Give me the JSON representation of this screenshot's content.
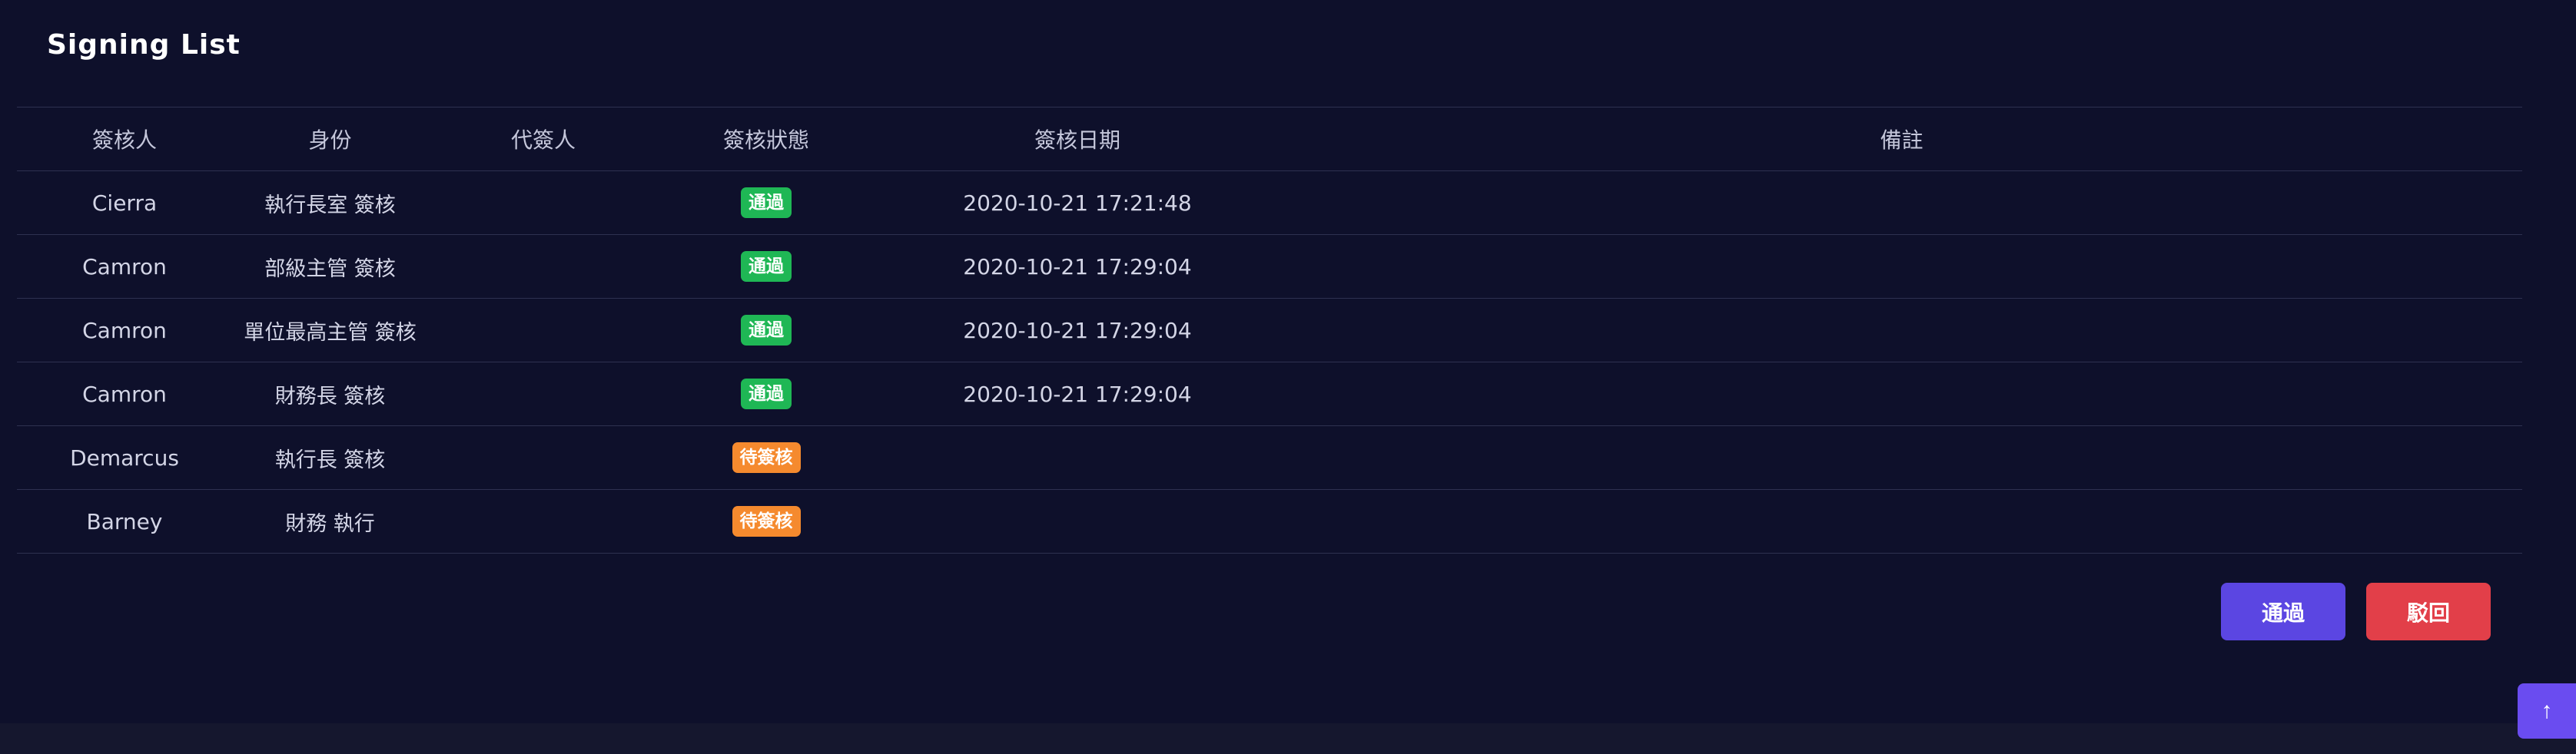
{
  "page": {
    "title": "Signing List"
  },
  "table": {
    "headers": [
      "簽核人",
      "身份",
      "代簽人",
      "簽核狀態",
      "簽核日期",
      "備註"
    ],
    "rows": [
      {
        "signer": "Cierra",
        "role": "執行長室 簽核",
        "proxy": "",
        "status": "通過",
        "status_type": "approved",
        "date": "2020-10-21 17:21:48",
        "note": ""
      },
      {
        "signer": "Camron",
        "role": "部級主管 簽核",
        "proxy": "",
        "status": "通過",
        "status_type": "approved",
        "date": "2020-10-21 17:29:04",
        "note": ""
      },
      {
        "signer": "Camron",
        "role": "單位最高主管 簽核",
        "proxy": "",
        "status": "通過",
        "status_type": "approved",
        "date": "2020-10-21 17:29:04",
        "note": ""
      },
      {
        "signer": "Camron",
        "role": "財務長 簽核",
        "proxy": "",
        "status": "通過",
        "status_type": "approved",
        "date": "2020-10-21 17:29:04",
        "note": ""
      },
      {
        "signer": "Demarcus",
        "role": "執行長 簽核",
        "proxy": "",
        "status": "待簽核",
        "status_type": "pending",
        "date": "",
        "note": ""
      },
      {
        "signer": "Barney",
        "role": "財務 執行",
        "proxy": "",
        "status": "待簽核",
        "status_type": "pending",
        "date": "",
        "note": ""
      }
    ]
  },
  "actions": {
    "approve_label": "通過",
    "reject_label": "駁回"
  },
  "scroll_top": {
    "icon": "arrow-up-icon",
    "glyph": "↑"
  },
  "colors": {
    "approved": "#1fb755",
    "pending": "#f58a2e",
    "approve_button": "#5b46e2",
    "reject_button": "#e23f49"
  }
}
